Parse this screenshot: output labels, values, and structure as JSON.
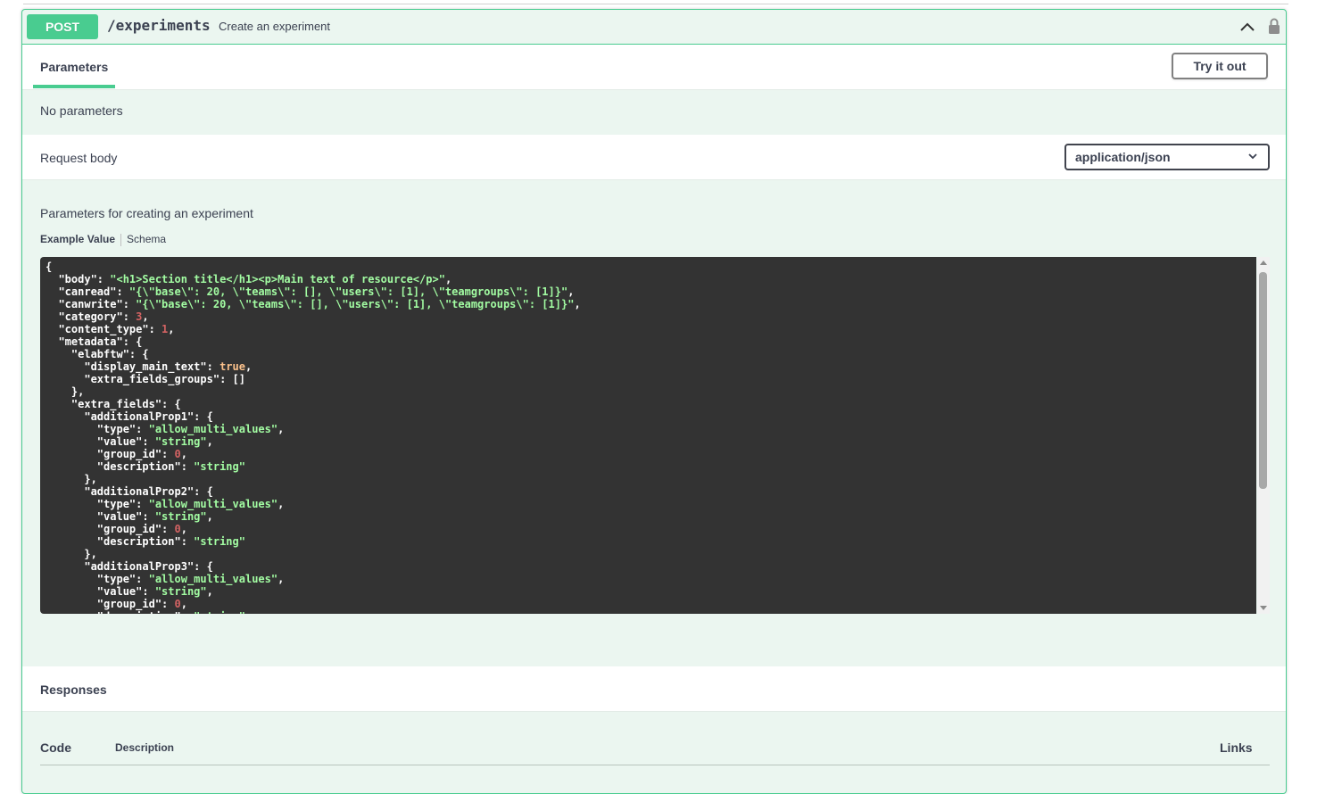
{
  "operation": {
    "method": "POST",
    "path": "/experiments",
    "summary": "Create an experiment"
  },
  "parameters": {
    "tab_label": "Parameters",
    "try_button": "Try it out",
    "empty_text": "No parameters"
  },
  "request_body": {
    "title": "Request body",
    "content_type": "application/json",
    "description": "Parameters for creating an experiment",
    "tab_example": "Example Value",
    "tab_schema": "Schema"
  },
  "example_json": [
    [
      {
        "t": "p",
        "v": "{"
      }
    ],
    [
      {
        "t": "p",
        "v": "  \"body\": "
      },
      {
        "t": "s",
        "v": "\"<h1>Section title</h1><p>Main text of resource</p>\""
      },
      {
        "t": "p",
        "v": ","
      }
    ],
    [
      {
        "t": "p",
        "v": "  \"canread\": "
      },
      {
        "t": "s",
        "v": "\"{\\\"base\\\": 20, \\\"teams\\\": [], \\\"users\\\": [1], \\\"teamgroups\\\": [1]}\""
      },
      {
        "t": "p",
        "v": ","
      }
    ],
    [
      {
        "t": "p",
        "v": "  \"canwrite\": "
      },
      {
        "t": "s",
        "v": "\"{\\\"base\\\": 20, \\\"teams\\\": [], \\\"users\\\": [1], \\\"teamgroups\\\": [1]}\""
      },
      {
        "t": "p",
        "v": ","
      }
    ],
    [
      {
        "t": "p",
        "v": "  \"category\": "
      },
      {
        "t": "n",
        "v": "3"
      },
      {
        "t": "p",
        "v": ","
      }
    ],
    [
      {
        "t": "p",
        "v": "  \"content_type\": "
      },
      {
        "t": "n",
        "v": "1"
      },
      {
        "t": "p",
        "v": ","
      }
    ],
    [
      {
        "t": "p",
        "v": "  \"metadata\": {"
      }
    ],
    [
      {
        "t": "p",
        "v": "    \"elabftw\": {"
      }
    ],
    [
      {
        "t": "p",
        "v": "      \"display_main_text\": "
      },
      {
        "t": "b",
        "v": "true"
      },
      {
        "t": "p",
        "v": ","
      }
    ],
    [
      {
        "t": "p",
        "v": "      \"extra_fields_groups\": []"
      }
    ],
    [
      {
        "t": "p",
        "v": "    },"
      }
    ],
    [
      {
        "t": "p",
        "v": "    \"extra_fields\": {"
      }
    ],
    [
      {
        "t": "p",
        "v": "      \"additionalProp1\": {"
      }
    ],
    [
      {
        "t": "p",
        "v": "        \"type\": "
      },
      {
        "t": "s",
        "v": "\"allow_multi_values\""
      },
      {
        "t": "p",
        "v": ","
      }
    ],
    [
      {
        "t": "p",
        "v": "        \"value\": "
      },
      {
        "t": "s",
        "v": "\"string\""
      },
      {
        "t": "p",
        "v": ","
      }
    ],
    [
      {
        "t": "p",
        "v": "        \"group_id\": "
      },
      {
        "t": "n",
        "v": "0"
      },
      {
        "t": "p",
        "v": ","
      }
    ],
    [
      {
        "t": "p",
        "v": "        \"description\": "
      },
      {
        "t": "s",
        "v": "\"string\""
      }
    ],
    [
      {
        "t": "p",
        "v": "      },"
      }
    ],
    [
      {
        "t": "p",
        "v": "      \"additionalProp2\": {"
      }
    ],
    [
      {
        "t": "p",
        "v": "        \"type\": "
      },
      {
        "t": "s",
        "v": "\"allow_multi_values\""
      },
      {
        "t": "p",
        "v": ","
      }
    ],
    [
      {
        "t": "p",
        "v": "        \"value\": "
      },
      {
        "t": "s",
        "v": "\"string\""
      },
      {
        "t": "p",
        "v": ","
      }
    ],
    [
      {
        "t": "p",
        "v": "        \"group_id\": "
      },
      {
        "t": "n",
        "v": "0"
      },
      {
        "t": "p",
        "v": ","
      }
    ],
    [
      {
        "t": "p",
        "v": "        \"description\": "
      },
      {
        "t": "s",
        "v": "\"string\""
      }
    ],
    [
      {
        "t": "p",
        "v": "      },"
      }
    ],
    [
      {
        "t": "p",
        "v": "      \"additionalProp3\": {"
      }
    ],
    [
      {
        "t": "p",
        "v": "        \"type\": "
      },
      {
        "t": "s",
        "v": "\"allow_multi_values\""
      },
      {
        "t": "p",
        "v": ","
      }
    ],
    [
      {
        "t": "p",
        "v": "        \"value\": "
      },
      {
        "t": "s",
        "v": "\"string\""
      },
      {
        "t": "p",
        "v": ","
      }
    ],
    [
      {
        "t": "p",
        "v": "        \"group_id\": "
      },
      {
        "t": "n",
        "v": "0"
      },
      {
        "t": "p",
        "v": ","
      }
    ],
    [
      {
        "t": "p",
        "v": "        \"description\": "
      },
      {
        "t": "s",
        "v": "\"string\""
      }
    ]
  ],
  "responses": {
    "title": "Responses",
    "col_code": "Code",
    "col_description": "Description",
    "col_links": "Links"
  },
  "icons": {
    "collapse": "chevron-up-icon",
    "auth": "lock-icon",
    "dropdown": "chevron-down-icon"
  },
  "colors": {
    "post_accent": "#49cc90",
    "panel_bg": "#ebf6f0",
    "code_bg": "#333333",
    "code_string": "#a2fca2",
    "code_number": "#d36363",
    "code_boolean": "#fcc28c"
  }
}
